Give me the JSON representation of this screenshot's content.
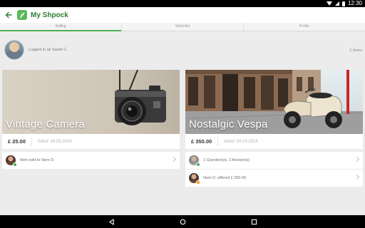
{
  "status_bar": {
    "time": "12:30"
  },
  "app_bar": {
    "title": "My Shpock"
  },
  "tabs": [
    {
      "label": "Selling",
      "active": true
    },
    {
      "label": "Watchlist",
      "active": false
    },
    {
      "label": "Profile",
      "active": false
    }
  ],
  "user": {
    "logged_in_text": "Logged in as Sarah C.",
    "items_count": "2 items"
  },
  "listings": [
    {
      "title": "Vintage Camera",
      "price": "£ 25.00",
      "listed": "listed: 04.03.2014",
      "activities": [
        {
          "text": "Item sold to Nem D.",
          "badge_color": "#4caf50"
        }
      ]
    },
    {
      "title": "Nostalgic Vespa",
      "price": "£ 350.00",
      "listed": "listed: 04.03.2014",
      "activities": [
        {
          "text": "1 Question(s), 2 Answer(s)",
          "badge_color": "#4caf50"
        },
        {
          "text": "Nem D. offered £ 250.00",
          "badge_color": "#ff9800"
        }
      ]
    }
  ],
  "colors": {
    "accent": "#4caf50",
    "title": "#2e7d32"
  }
}
